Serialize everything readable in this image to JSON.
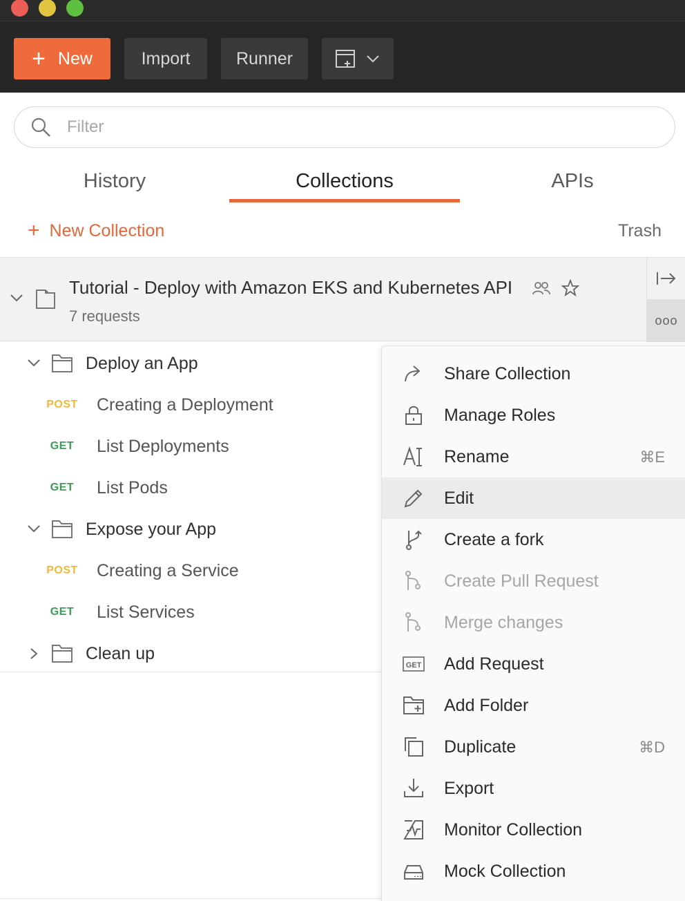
{
  "toolbar": {
    "new_label": "New",
    "import_label": "Import",
    "runner_label": "Runner"
  },
  "filter": {
    "placeholder": "Filter"
  },
  "tabs": {
    "history": "History",
    "collections": "Collections",
    "apis": "APIs",
    "active": "Collections"
  },
  "actions": {
    "new_collection": "New Collection",
    "trash": "Trash"
  },
  "collection": {
    "title": "Tutorial - Deploy with Amazon EKS and Kubernetes API",
    "subtitle": "7 requests",
    "more_label": "ooo"
  },
  "tree": {
    "folder1": "Deploy an App",
    "req1_method": "POST",
    "req1_label": "Creating a Deployment",
    "req2_method": "GET",
    "req2_label": "List Deployments",
    "req3_method": "GET",
    "req3_label": "List Pods",
    "folder2": "Expose your App",
    "req4_method": "POST",
    "req4_label": "Creating a Service",
    "req5_method": "GET",
    "req5_label": "List Services",
    "folder3": "Clean up"
  },
  "menu": {
    "share": "Share Collection",
    "roles": "Manage Roles",
    "rename": "Rename",
    "rename_shortcut": "⌘E",
    "edit": "Edit",
    "fork": "Create a fork",
    "pull": "Create Pull Request",
    "merge": "Merge changes",
    "add_request": "Add Request",
    "add_request_badge": "GET",
    "add_folder": "Add Folder",
    "duplicate": "Duplicate",
    "duplicate_shortcut": "⌘D",
    "export": "Export",
    "monitor": "Monitor Collection",
    "mock": "Mock Collection"
  },
  "colors": {
    "accent": "#e5673a",
    "new_button": "#ef6b3c",
    "post": "#f0b93a",
    "get": "#3d9b55",
    "toolbar_bg": "#262626"
  }
}
